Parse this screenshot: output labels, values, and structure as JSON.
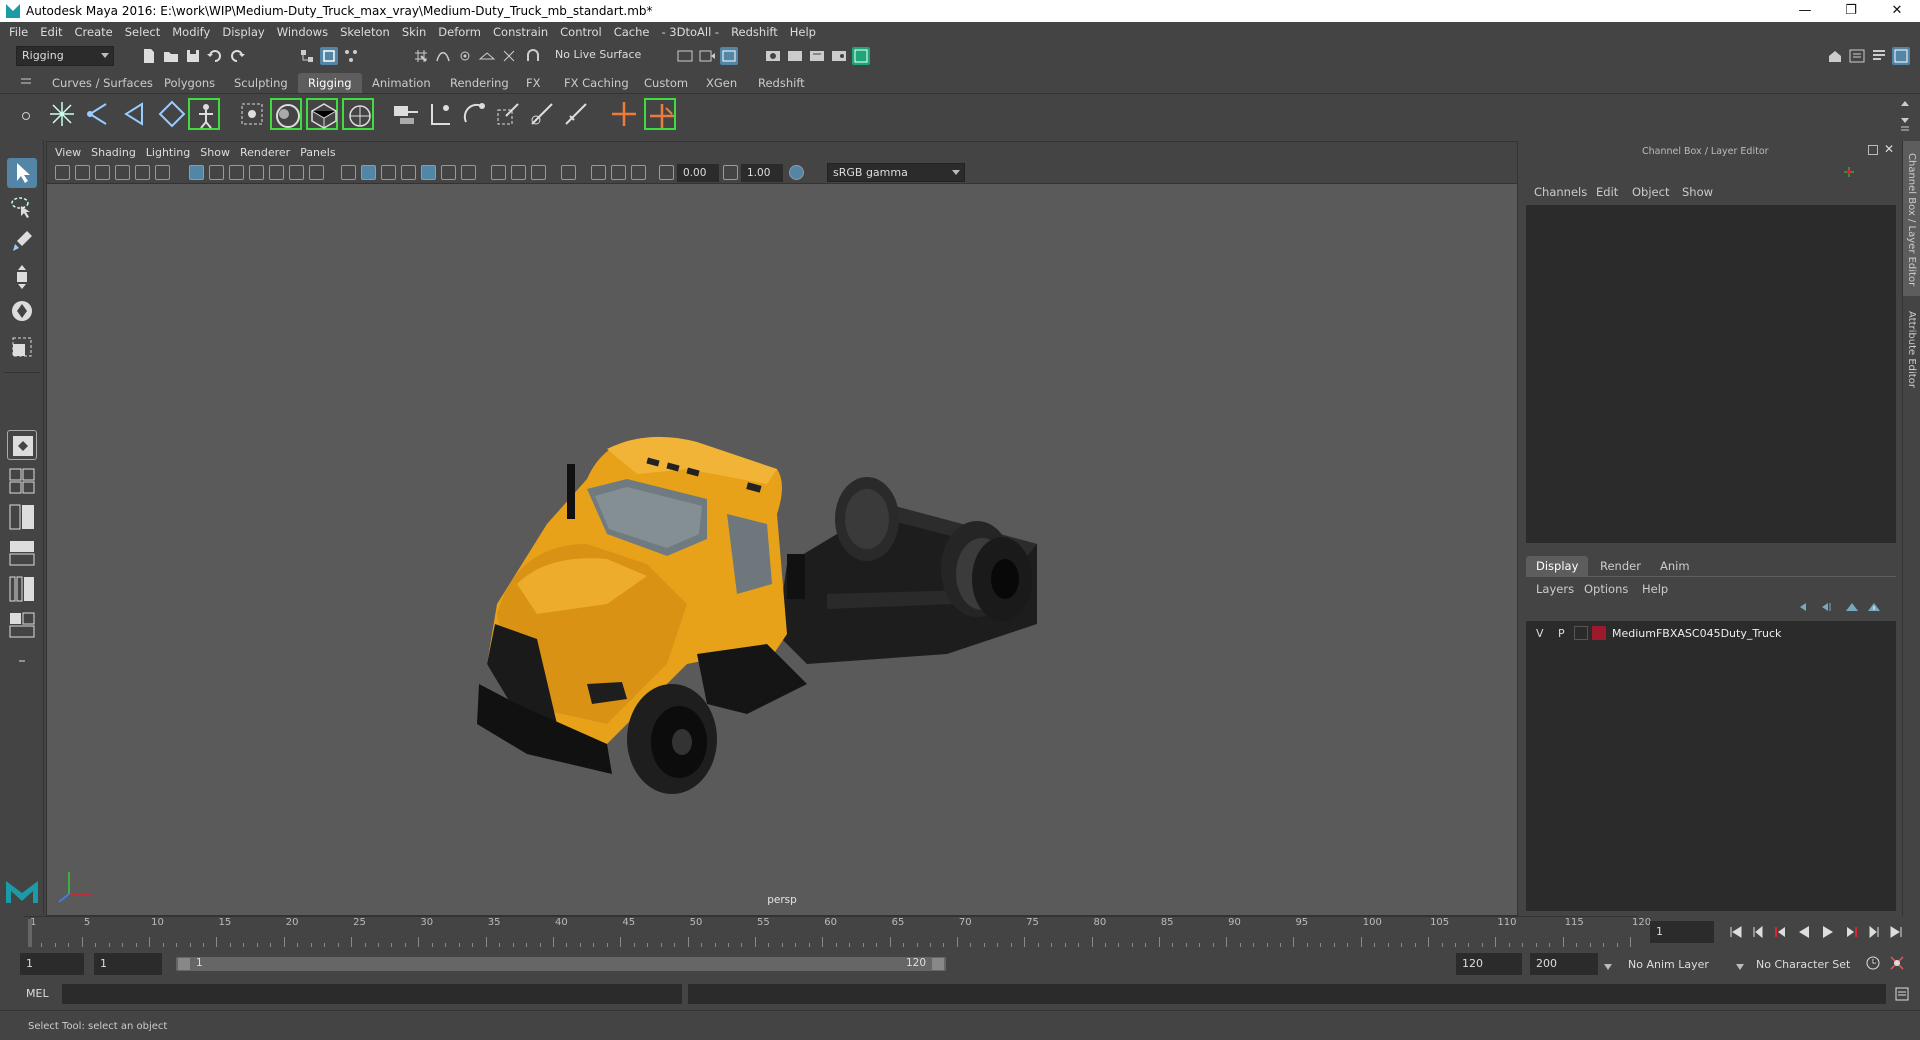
{
  "window": {
    "title": "Autodesk Maya 2016: E:\\work\\WIP\\Medium-Duty_Truck_max_vray\\Medium-Duty_Truck_mb_standart.mb*",
    "minimize": "—",
    "restore": "❐",
    "close": "✕"
  },
  "menubar": [
    "File",
    "Edit",
    "Create",
    "Select",
    "Modify",
    "Display",
    "Windows",
    "Skeleton",
    "Skin",
    "Deform",
    "Constrain",
    "Control",
    "Cache",
    "- 3DtoAll -",
    "Redshift",
    "Help"
  ],
  "statusline": {
    "mode": "Rigging",
    "live_surface": "No Live Surface"
  },
  "shelf_tabs": [
    "Curves / Surfaces",
    "Polygons",
    "Sculpting",
    "Rigging",
    "Animation",
    "Rendering",
    "FX",
    "FX Caching",
    "Custom",
    "XGen",
    "Redshift"
  ],
  "shelf_active": "Rigging",
  "viewport": {
    "menu": [
      "View",
      "Shading",
      "Lighting",
      "Show",
      "Renderer",
      "Panels"
    ],
    "exposure": "0.00",
    "gamma": "1.00",
    "color_space": "sRGB gamma",
    "camera": "persp"
  },
  "channel_box": {
    "title": "Channel Box / Layer Editor",
    "menu": [
      "Channels",
      "Edit",
      "Object",
      "Show"
    ],
    "side_tabs": [
      "Channel Box / Layer Editor",
      "Attribute Editor"
    ]
  },
  "layer_editor": {
    "tabs": [
      "Display",
      "Render",
      "Anim"
    ],
    "active_tab": "Display",
    "menu": [
      "Layers",
      "Options",
      "Help"
    ],
    "layers": [
      {
        "v": "V",
        "p": "P",
        "name": "MediumFBXASC045Duty_Truck",
        "color": "#9b1a2e"
      }
    ]
  },
  "timeline": {
    "ticks": [
      "1",
      "5",
      "10",
      "15",
      "20",
      "25",
      "30",
      "35",
      "40",
      "45",
      "50",
      "55",
      "60",
      "65",
      "70",
      "75",
      "80",
      "85",
      "90",
      "95",
      "100",
      "105",
      "110",
      "115",
      "120"
    ],
    "current_frame": "1"
  },
  "range": {
    "start": "1",
    "playback_start": "1",
    "slider_start": "1",
    "slider_end": "120",
    "playback_end": "120",
    "end": "200",
    "anim_layer": "No Anim Layer",
    "character_set": "No Character Set"
  },
  "command": {
    "label": "MEL"
  },
  "help_line": "Select Tool: select an object",
  "colors": {
    "truck_body": "#e8a21a",
    "accent": "#5285a6",
    "highlight_green": "#3fdc3f"
  }
}
